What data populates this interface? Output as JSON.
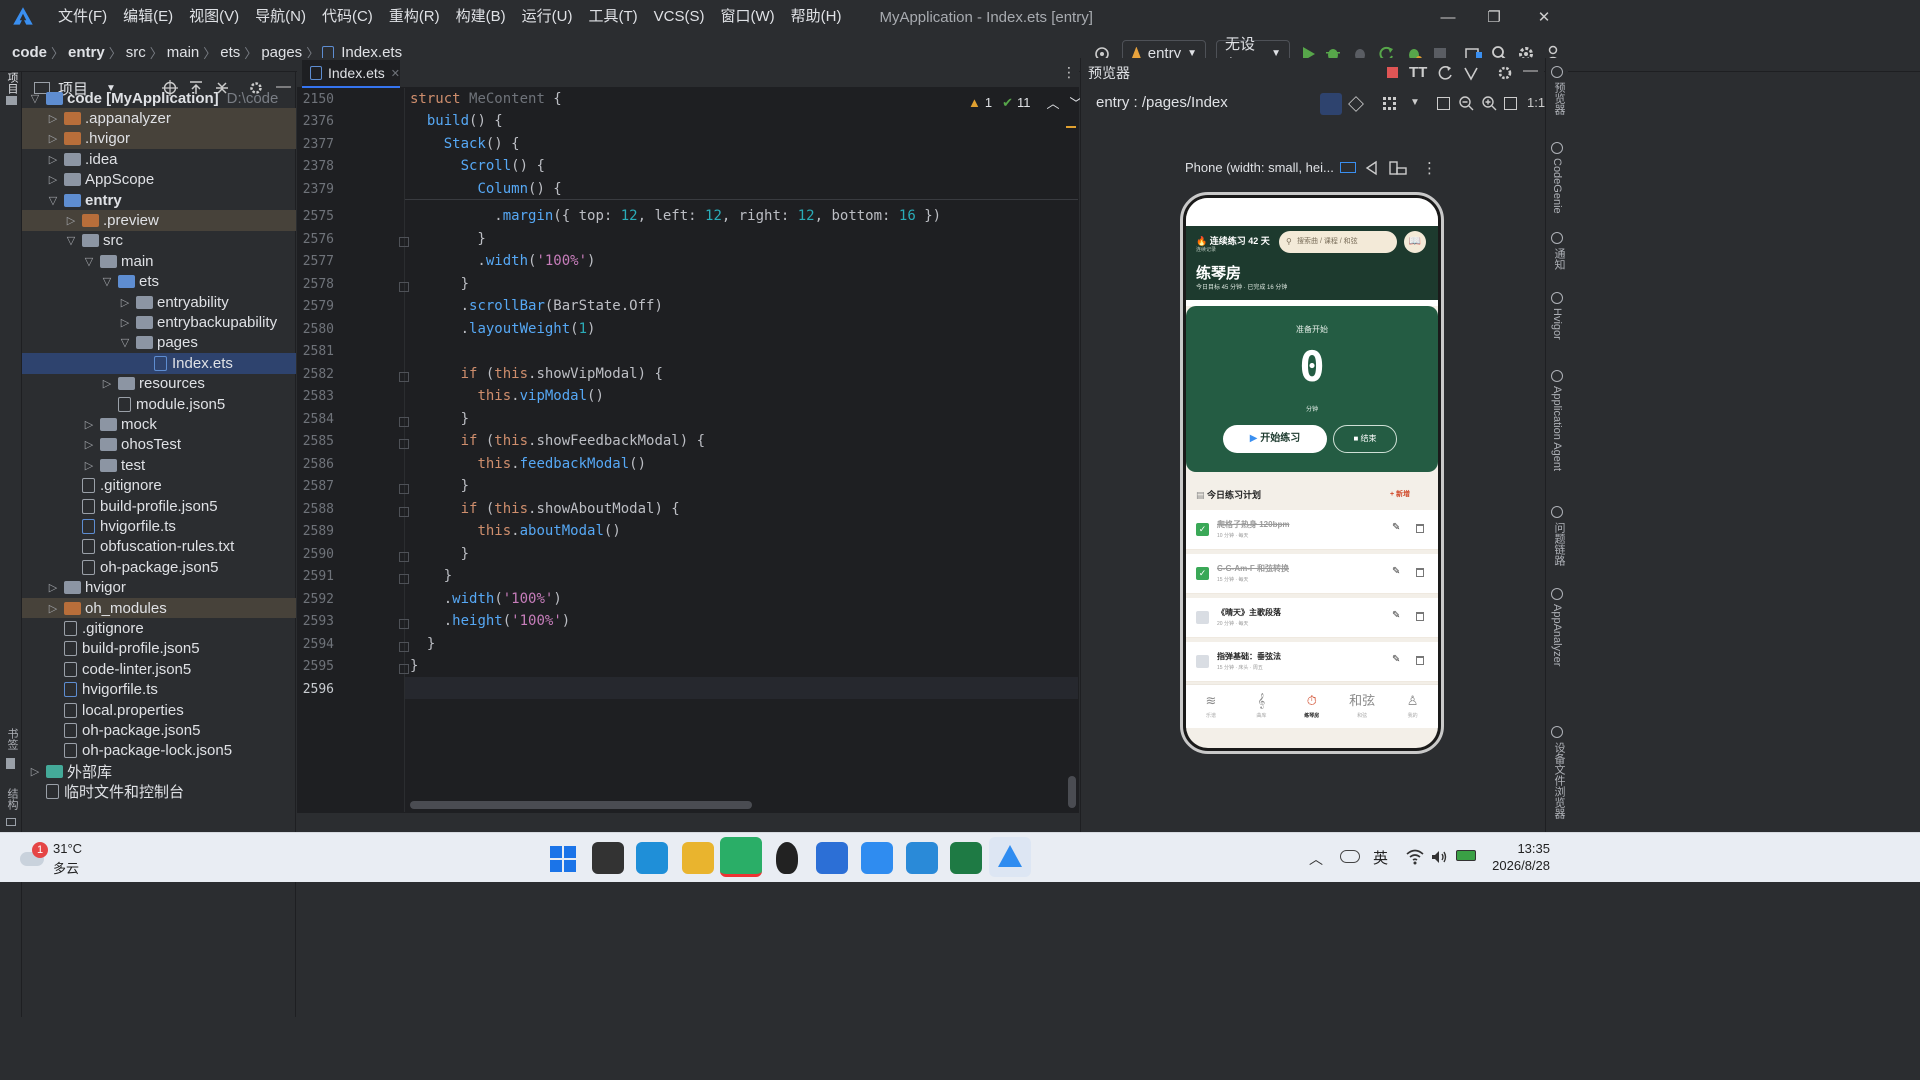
{
  "menubar": {
    "items": [
      "文件(F)",
      "编辑(E)",
      "视图(V)",
      "导航(N)",
      "代码(C)",
      "重构(R)",
      "构建(B)",
      "运行(U)",
      "工具(T)",
      "VCS(S)",
      "窗口(W)",
      "帮助(H)"
    ],
    "title": "MyApplication - Index.ets [entry]"
  },
  "toolbar": {
    "breadcrumbs": [
      "code",
      "entry",
      "src",
      "main",
      "ets",
      "pages",
      "Index.ets"
    ],
    "module": "entry",
    "device": "无设备"
  },
  "project": {
    "header": "项目",
    "tree": [
      {
        "label": "code [MyApplication]",
        "extra": "D:\\code",
        "depth": 0,
        "chev": "v",
        "icon": "folder-b"
      },
      {
        "label": ".appanalyzer",
        "depth": 1,
        "chev": ">",
        "icon": "folder-o",
        "hl": true
      },
      {
        "label": ".hvigor",
        "depth": 1,
        "chev": ">",
        "icon": "folder-o",
        "hl": true
      },
      {
        "label": ".idea",
        "depth": 1,
        "chev": ">",
        "icon": "folder"
      },
      {
        "label": "AppScope",
        "depth": 1,
        "chev": ">",
        "icon": "folder"
      },
      {
        "label": "entry",
        "depth": 1,
        "chev": "v",
        "icon": "folder-b",
        "bold": true
      },
      {
        "label": ".preview",
        "depth": 2,
        "chev": ">",
        "icon": "folder-o",
        "hl": true
      },
      {
        "label": "src",
        "depth": 2,
        "chev": "v",
        "icon": "folder"
      },
      {
        "label": "main",
        "depth": 3,
        "chev": "v",
        "icon": "folder"
      },
      {
        "label": "ets",
        "depth": 4,
        "chev": "v",
        "icon": "folder-b"
      },
      {
        "label": "entryability",
        "depth": 5,
        "chev": ">",
        "icon": "folder"
      },
      {
        "label": "entrybackupability",
        "depth": 5,
        "chev": ">",
        "icon": "folder"
      },
      {
        "label": "pages",
        "depth": 5,
        "chev": "v",
        "icon": "folder"
      },
      {
        "label": "Index.ets",
        "depth": 6,
        "chev": "",
        "icon": "file-ts",
        "sel": true
      },
      {
        "label": "resources",
        "depth": 4,
        "chev": ">",
        "icon": "folder"
      },
      {
        "label": "module.json5",
        "depth": 4,
        "chev": "",
        "icon": "file"
      },
      {
        "label": "mock",
        "depth": 3,
        "chev": ">",
        "icon": "folder"
      },
      {
        "label": "ohosTest",
        "depth": 3,
        "chev": ">",
        "icon": "folder"
      },
      {
        "label": "test",
        "depth": 3,
        "chev": ">",
        "icon": "folder"
      },
      {
        "label": ".gitignore",
        "depth": 2,
        "chev": "",
        "icon": "file"
      },
      {
        "label": "build-profile.json5",
        "depth": 2,
        "chev": "",
        "icon": "file"
      },
      {
        "label": "hvigorfile.ts",
        "depth": 2,
        "chev": "",
        "icon": "file-ts"
      },
      {
        "label": "obfuscation-rules.txt",
        "depth": 2,
        "chev": "",
        "icon": "file"
      },
      {
        "label": "oh-package.json5",
        "depth": 2,
        "chev": "",
        "icon": "file"
      },
      {
        "label": "hvigor",
        "depth": 1,
        "chev": ">",
        "icon": "folder"
      },
      {
        "label": "oh_modules",
        "depth": 1,
        "chev": ">",
        "icon": "folder-o",
        "hl": true
      },
      {
        "label": ".gitignore",
        "depth": 1,
        "chev": "",
        "icon": "file"
      },
      {
        "label": "build-profile.json5",
        "depth": 1,
        "chev": "",
        "icon": "file"
      },
      {
        "label": "code-linter.json5",
        "depth": 1,
        "chev": "",
        "icon": "file"
      },
      {
        "label": "hvigorfile.ts",
        "depth": 1,
        "chev": "",
        "icon": "file-ts"
      },
      {
        "label": "local.properties",
        "depth": 1,
        "chev": "",
        "icon": "file"
      },
      {
        "label": "oh-package.json5",
        "depth": 1,
        "chev": "",
        "icon": "file"
      },
      {
        "label": "oh-package-lock.json5",
        "depth": 1,
        "chev": "",
        "icon": "file"
      },
      {
        "label": "外部库",
        "depth": 0,
        "chev": ">",
        "icon": "lib"
      },
      {
        "label": "临时文件和控制台",
        "depth": 0,
        "chev": "",
        "icon": "scratch"
      }
    ]
  },
  "editor": {
    "tab": "Index.ets",
    "warnings": "1",
    "checks": "11",
    "lines": [
      {
        "n": "2150",
        "html": "<span class='kw'>struct</span> <span class='cls'>MeContent</span> {"
      },
      {
        "n": "2376",
        "html": "  <span class='fn'>build</span>() {"
      },
      {
        "n": "2377",
        "html": "    <span class='fn'>Stack</span>() {"
      },
      {
        "n": "2378",
        "html": "      <span class='fn'>Scroll</span>() {"
      },
      {
        "n": "2379",
        "html": "        <span class='fn'>Column</span>() {"
      },
      {
        "n": "2575",
        "html": "          .<span class='fn'>margin</span>({ top: <span class='nm'>12</span>, left: <span class='nm'>12</span>, right: <span class='nm'>12</span>, bottom: <span class='nm'>16</span> })"
      },
      {
        "n": "2576",
        "html": "        }"
      },
      {
        "n": "2577",
        "html": "        .<span class='fn'>width</span>(<span class='st'>'100%'</span>)"
      },
      {
        "n": "2578",
        "html": "      }"
      },
      {
        "n": "2579",
        "html": "      .<span class='fn'>scrollBar</span>(BarState.Off)"
      },
      {
        "n": "2580",
        "html": "      .<span class='fn'>layoutWeight</span>(<span class='nm'>1</span>)"
      },
      {
        "n": "2581",
        "html": ""
      },
      {
        "n": "2582",
        "html": "      <span class='kw'>if</span> (<span class='kw'>this</span>.showVipModal) {"
      },
      {
        "n": "2583",
        "html": "        <span class='kw'>this</span>.<span class='fn'>vipModal</span>()"
      },
      {
        "n": "2584",
        "html": "      }"
      },
      {
        "n": "2585",
        "html": "      <span class='kw'>if</span> (<span class='kw'>this</span>.showFeedbackModal) {"
      },
      {
        "n": "2586",
        "html": "        <span class='kw'>this</span>.<span class='fn'>feedbackModal</span>()"
      },
      {
        "n": "2587",
        "html": "      }"
      },
      {
        "n": "2588",
        "html": "      <span class='kw'>if</span> (<span class='kw'>this</span>.showAboutModal) {"
      },
      {
        "n": "2589",
        "html": "        <span class='kw'>this</span>.<span class='fn'>aboutModal</span>()"
      },
      {
        "n": "2590",
        "html": "      }"
      },
      {
        "n": "2591",
        "html": "    }"
      },
      {
        "n": "2592",
        "html": "    .<span class='fn'>width</span>(<span class='st'>'100%'</span>)"
      },
      {
        "n": "2593",
        "html": "    .<span class='fn'>height</span>(<span class='st'>'100%'</span>)"
      },
      {
        "n": "2594",
        "html": "  }"
      },
      {
        "n": "2595",
        "html": "}"
      },
      {
        "n": "2596",
        "html": ""
      }
    ]
  },
  "preview": {
    "header": "预览器",
    "route": "entry : /pages/Index",
    "device_label": "Phone (width: small, hei...",
    "app": {
      "streak": "连续练习 42 天",
      "streak_sub": "连续记录",
      "search_placeholder": "搜索曲 / 课程 / 和弦",
      "title": "练琴房",
      "subtitle": "今日目标 45 分钟 · 已完成 16 分钟",
      "ready": "准备开始",
      "minutes": "0",
      "minutes_unit": "分钟",
      "start_btn": "开始练习",
      "end_btn": "结束",
      "plan_title": "今日练习计划",
      "plan_add": "+ 新增",
      "plans": [
        {
          "title": "爬格子热身 120bpm",
          "meta": "10 分钟 · 每天",
          "done": true
        },
        {
          "title": "C-G-Am-F 和弦转换",
          "meta": "15 分钟 · 每天",
          "done": true
        },
        {
          "title": "《晴天》主歌段落",
          "meta": "20 分钟 · 每天",
          "done": false
        },
        {
          "title": "指弹基础：垂弦法",
          "meta": "15 分钟 · 床头 · 周五",
          "done": false
        }
      ],
      "tabs": [
        "乐谱",
        "曲库",
        "练琴房",
        "和弦",
        "我的"
      ],
      "tab_chord_glyph": "和弦"
    }
  },
  "right_strip": [
    "预览器",
    "CodeGenie",
    "通知",
    "Hvigor",
    "Application Agent",
    "问题链路",
    "AppAnalyzer",
    "设备文件浏览器"
  ],
  "left_strip": [
    "项目",
    "书签",
    "结构"
  ],
  "taskbar": {
    "weather_temp": "31°C",
    "weather_desc": "多云",
    "weather_badge": "1",
    "ime": "英",
    "time": "13:35",
    "date": "2026/8/28"
  },
  "colors": {
    "accent": "#3574f0",
    "app_green": "#245c43",
    "app_header": "#1d3a2e",
    "taskbar": "#e9edf3"
  }
}
